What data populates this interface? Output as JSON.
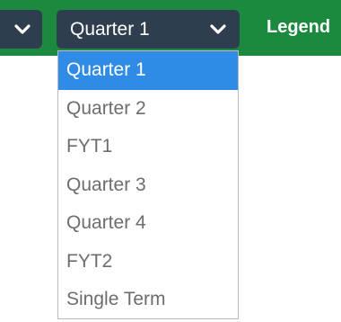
{
  "toolbar": {
    "prev_select": {
      "icon": "chevron-down-icon"
    },
    "quarter_select": {
      "value": "Quarter 1",
      "icon": "chevron-down-icon"
    },
    "legend_label": "Legend"
  },
  "dropdown": {
    "selected_index": 0,
    "options": [
      {
        "label": "Quarter 1"
      },
      {
        "label": "Quarter 2"
      },
      {
        "label": "FYT1"
      },
      {
        "label": "Quarter 3"
      },
      {
        "label": "Quarter 4"
      },
      {
        "label": "FYT2"
      },
      {
        "label": "Single Term"
      }
    ]
  },
  "colors": {
    "toolbar_bg": "#1b8a3e",
    "select_bg": "#2f3e4e",
    "selected_option_bg": "#2f8be6",
    "option_text": "#6d6d6d"
  }
}
